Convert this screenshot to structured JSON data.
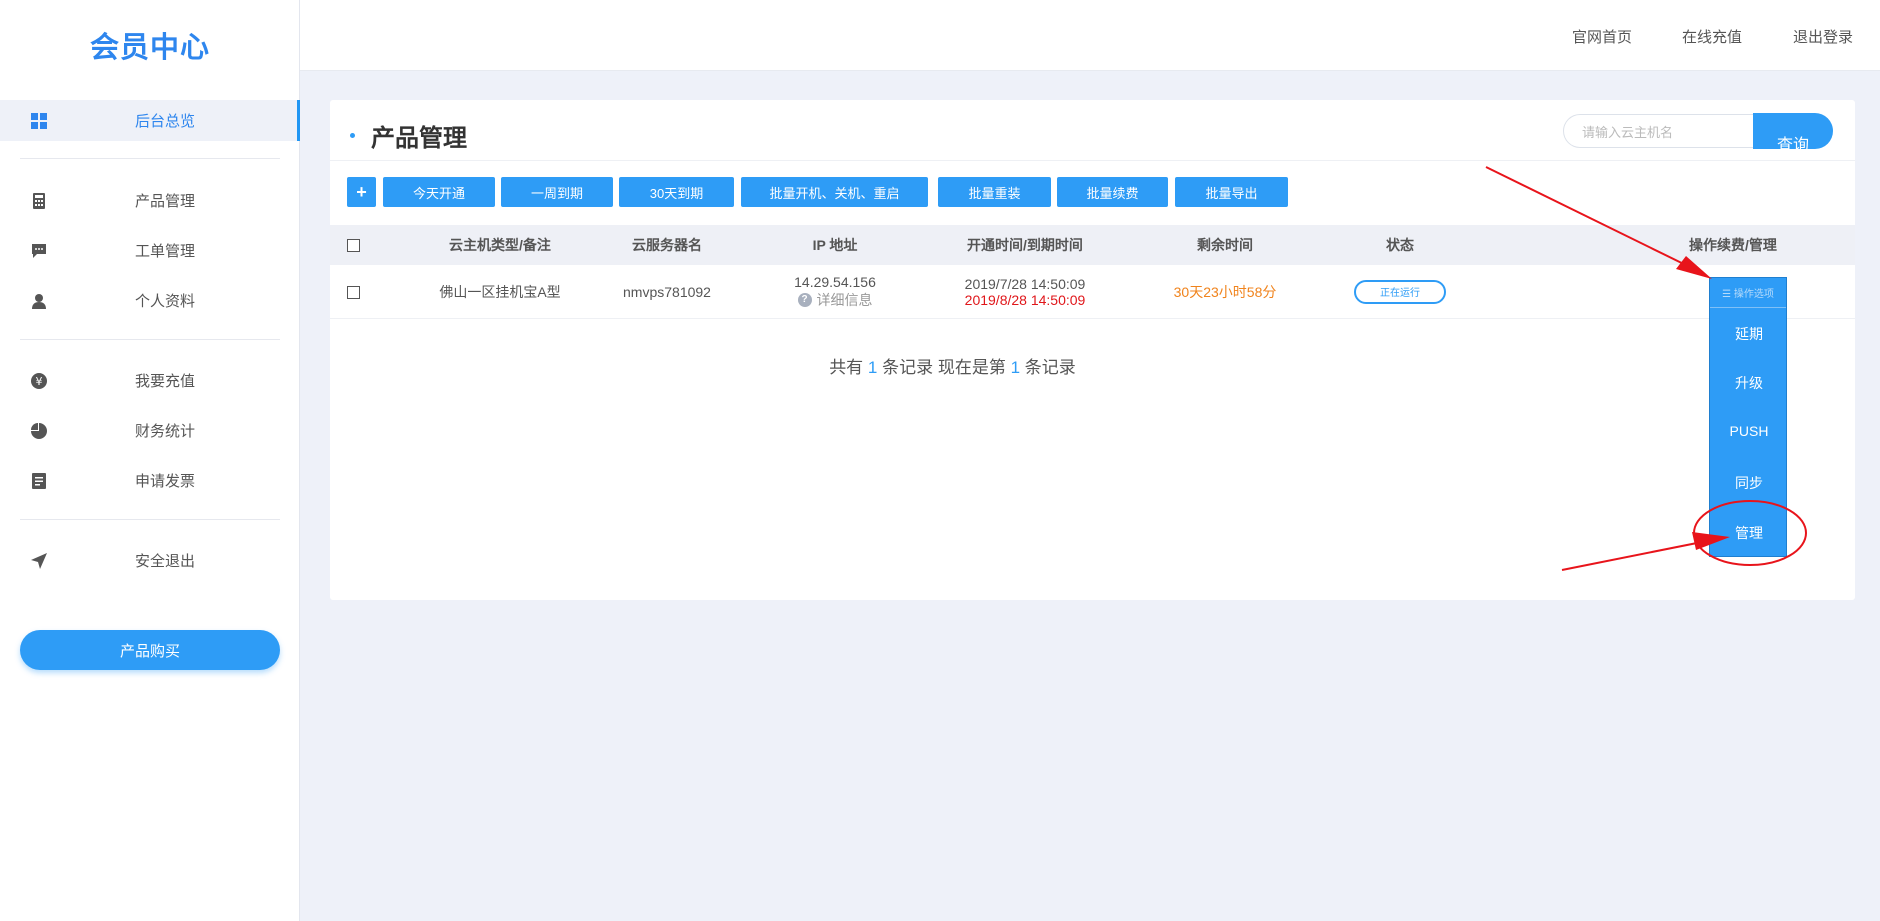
{
  "sidebar": {
    "logo": "会员中心",
    "items": [
      {
        "label": "后台总览",
        "icon": "dashboard-icon"
      },
      {
        "label": "产品管理",
        "icon": "calculator-icon"
      },
      {
        "label": "工单管理",
        "icon": "message-icon"
      },
      {
        "label": "个人资料",
        "icon": "user-icon"
      },
      {
        "label": "我要充值",
        "icon": "yen-icon"
      },
      {
        "label": "财务统计",
        "icon": "pie-chart-icon"
      },
      {
        "label": "申请发票",
        "icon": "invoice-icon"
      },
      {
        "label": "安全退出",
        "icon": "location-arrow-icon"
      }
    ],
    "buy_button": "产品购买"
  },
  "topbar": {
    "links": [
      "官网首页",
      "在线充值",
      "退出登录"
    ]
  },
  "panel": {
    "title": "产品管理",
    "search_placeholder": "请输入云主机名",
    "search_button": "查询",
    "toolbar": {
      "add": "+",
      "buttons": [
        "今天开通",
        "一周到期",
        "30天到期",
        "批量开机、关机、重启",
        "批量重装",
        "批量续费",
        "批量导出"
      ]
    },
    "table": {
      "headers": [
        "云主机类型/备注",
        "云服务器名",
        "IP 地址",
        "开通时间/到期时间",
        "剩余时间",
        "状态",
        "操作续费/管理"
      ],
      "rows": [
        {
          "type": "佛山一区挂机宝A型",
          "name": "nmvps781092",
          "ip": "14.29.54.156",
          "ip_detail": "详细信息",
          "open_time": "2019/7/28 14:50:09",
          "expire_time": "2019/8/28 14:50:09",
          "remaining": "30天23小时58分",
          "status": "正在运行"
        }
      ]
    },
    "pager": {
      "prefix": "共有",
      "total": "1",
      "mid": "条记录 现在是第",
      "current": "1",
      "suffix": "条记录"
    },
    "dropdown": {
      "header": "☰ 操作选项",
      "items": [
        "延期",
        "升级",
        "PUSH",
        "同步",
        "管理"
      ]
    }
  },
  "colors": {
    "accent": "#2e9cf6",
    "expire": "#e0161a",
    "remaining": "#f0831c",
    "annotation": "#e8141b"
  }
}
